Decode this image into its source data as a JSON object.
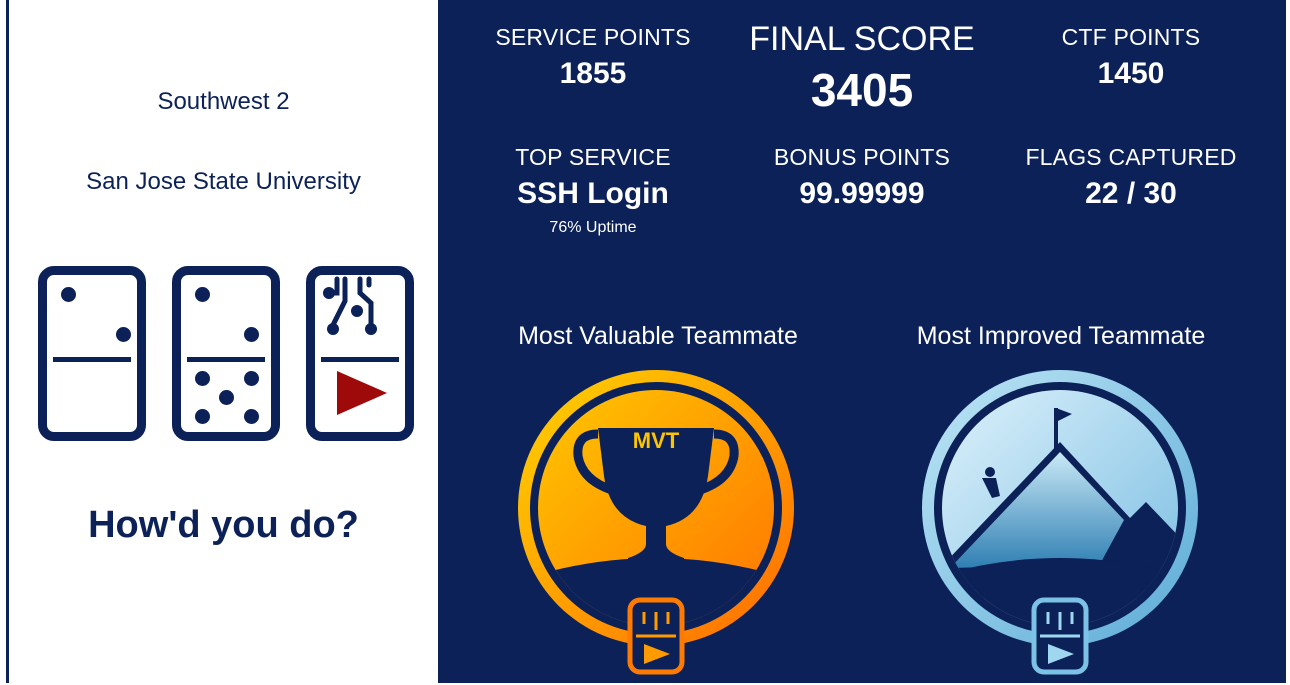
{
  "left_panel": {
    "region": "Southwest 2",
    "school": "San Jose State University",
    "tagline": "How'd you do?"
  },
  "scores": {
    "service_points": {
      "label": "SERVICE POINTS",
      "value": "1855"
    },
    "final_score": {
      "label": "FINAL SCORE",
      "value": "3405"
    },
    "ctf_points": {
      "label": "CTF POINTS",
      "value": "1450"
    },
    "top_service": {
      "label": "TOP SERVICE",
      "value": "SSH Login",
      "detail": "76% Uptime"
    },
    "bonus_points": {
      "label": "BONUS POINTS",
      "value": "99.99999"
    },
    "flags_captured": {
      "label": "FLAGS CAPTURED",
      "value": "22 / 30"
    }
  },
  "awards": {
    "mvt": {
      "title": "Most Valuable Teammate",
      "badge_text": "MVT"
    },
    "mit": {
      "title": "Most Improved Teammate"
    }
  },
  "colors": {
    "navy": "#0b2158",
    "play_red": "#9e0a0a",
    "mvt_orange": "#ff7a00",
    "mvt_yellow": "#ffc400",
    "mit_blue": "#3a8fc0"
  }
}
